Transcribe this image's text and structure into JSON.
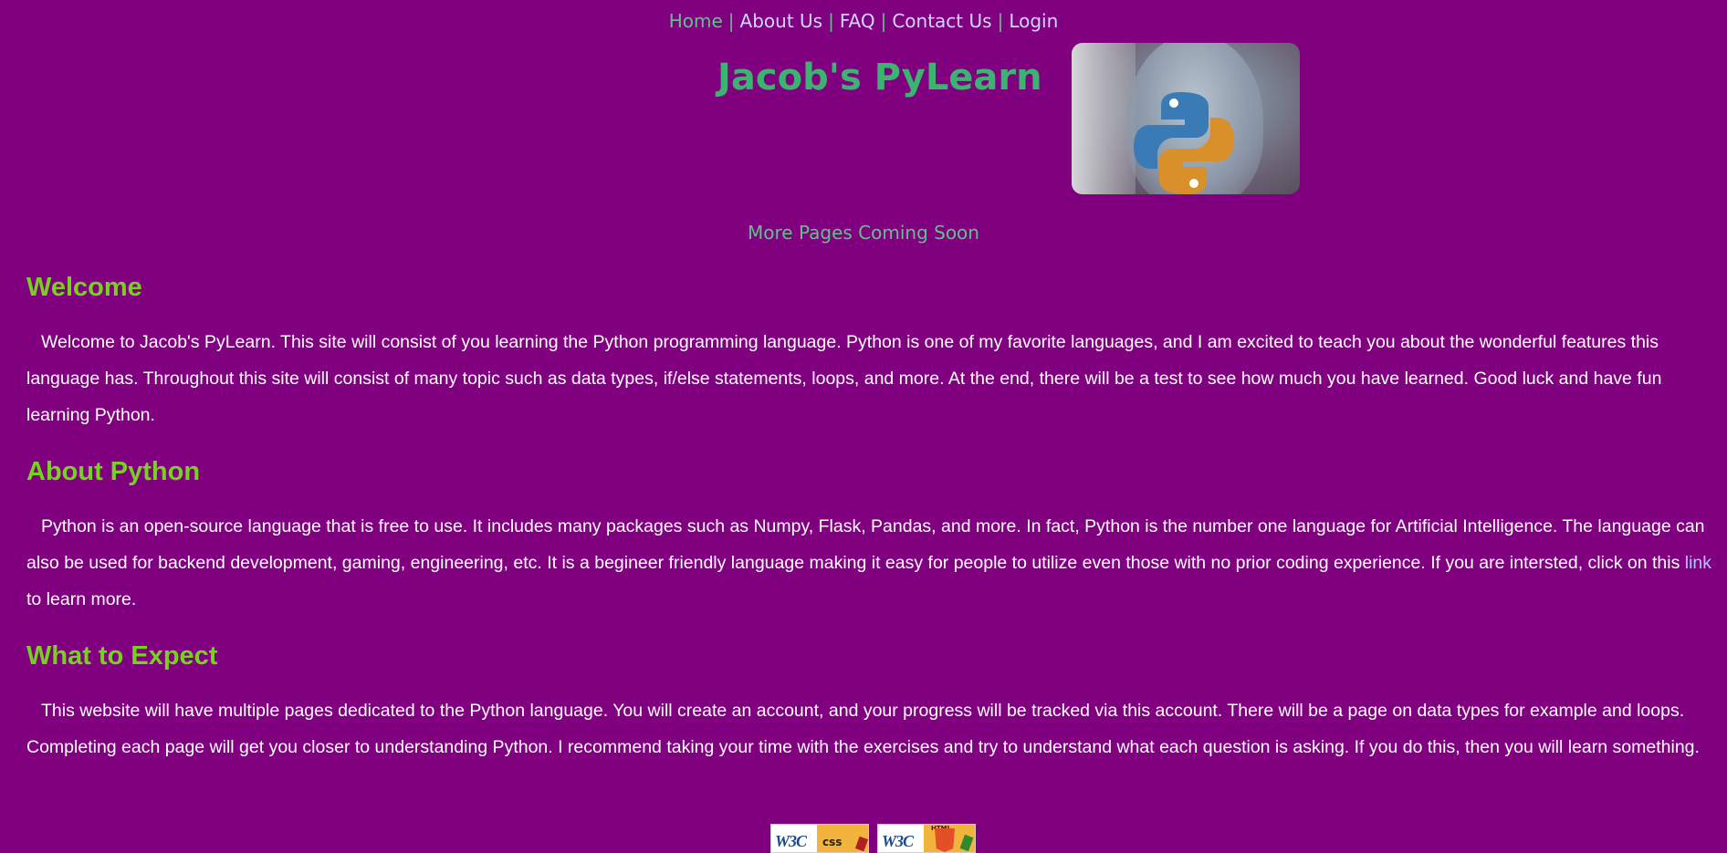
{
  "nav": {
    "items": [
      {
        "label": "Home",
        "active": true
      },
      {
        "label": "About Us",
        "active": false
      },
      {
        "label": "FAQ",
        "active": false
      },
      {
        "label": "Contact Us",
        "active": false
      },
      {
        "label": "Login",
        "active": false
      }
    ],
    "separator": "|"
  },
  "header": {
    "title": "Jacob's PyLearn",
    "image_icon": "python-logo-icon"
  },
  "notice": "More Pages Coming Soon",
  "sections": [
    {
      "heading": "Welcome",
      "body": "Welcome to Jacob's PyLearn. This site will consist of you learning the Python programming language. Python is one of my favorite languages, and I am excited to teach you about the wonderful features this language has. Throughout this site will consist of many topic such as data types, if/else statements, loops, and more. At the end, there will be a test to see how much you have learned. Good luck and have fun learning Python."
    },
    {
      "heading": "About Python",
      "body_before_link": "Python is an open-source language that is free to use. It includes many packages such as Numpy, Flask, Pandas, and more. In fact, Python is the number one language for Artificial Intelligence. The language can also be used for backend development, gaming, engineering, etc. It is a begineer friendly language making it easy for people to utilize even those with no prior coding experience. If you are intersted, click on this ",
      "link_text": "link",
      "body_after_link": " to learn more."
    },
    {
      "heading": "What to Expect",
      "body": "This website will have multiple pages dedicated to the Python language. You will create an account, and your progress will be tracked via this account. There will be a page on data types for example and loops. Completing each page will get you closer to understanding Python. I recommend taking your time with the exercises and try to understand what each question is asking. If you do this, then you will learn something."
    }
  ],
  "badges": {
    "css": {
      "w3c": "W3C",
      "label": "css"
    },
    "html": {
      "w3c": "W3C",
      "label": "HTML"
    }
  },
  "colors": {
    "background": "#800080",
    "nav_link": "#cfd7ff",
    "nav_active": "#62c08a",
    "title": "#3cb371",
    "heading": "#76d21e",
    "body_text": "#ffffff",
    "link": "#b0c4ff"
  }
}
